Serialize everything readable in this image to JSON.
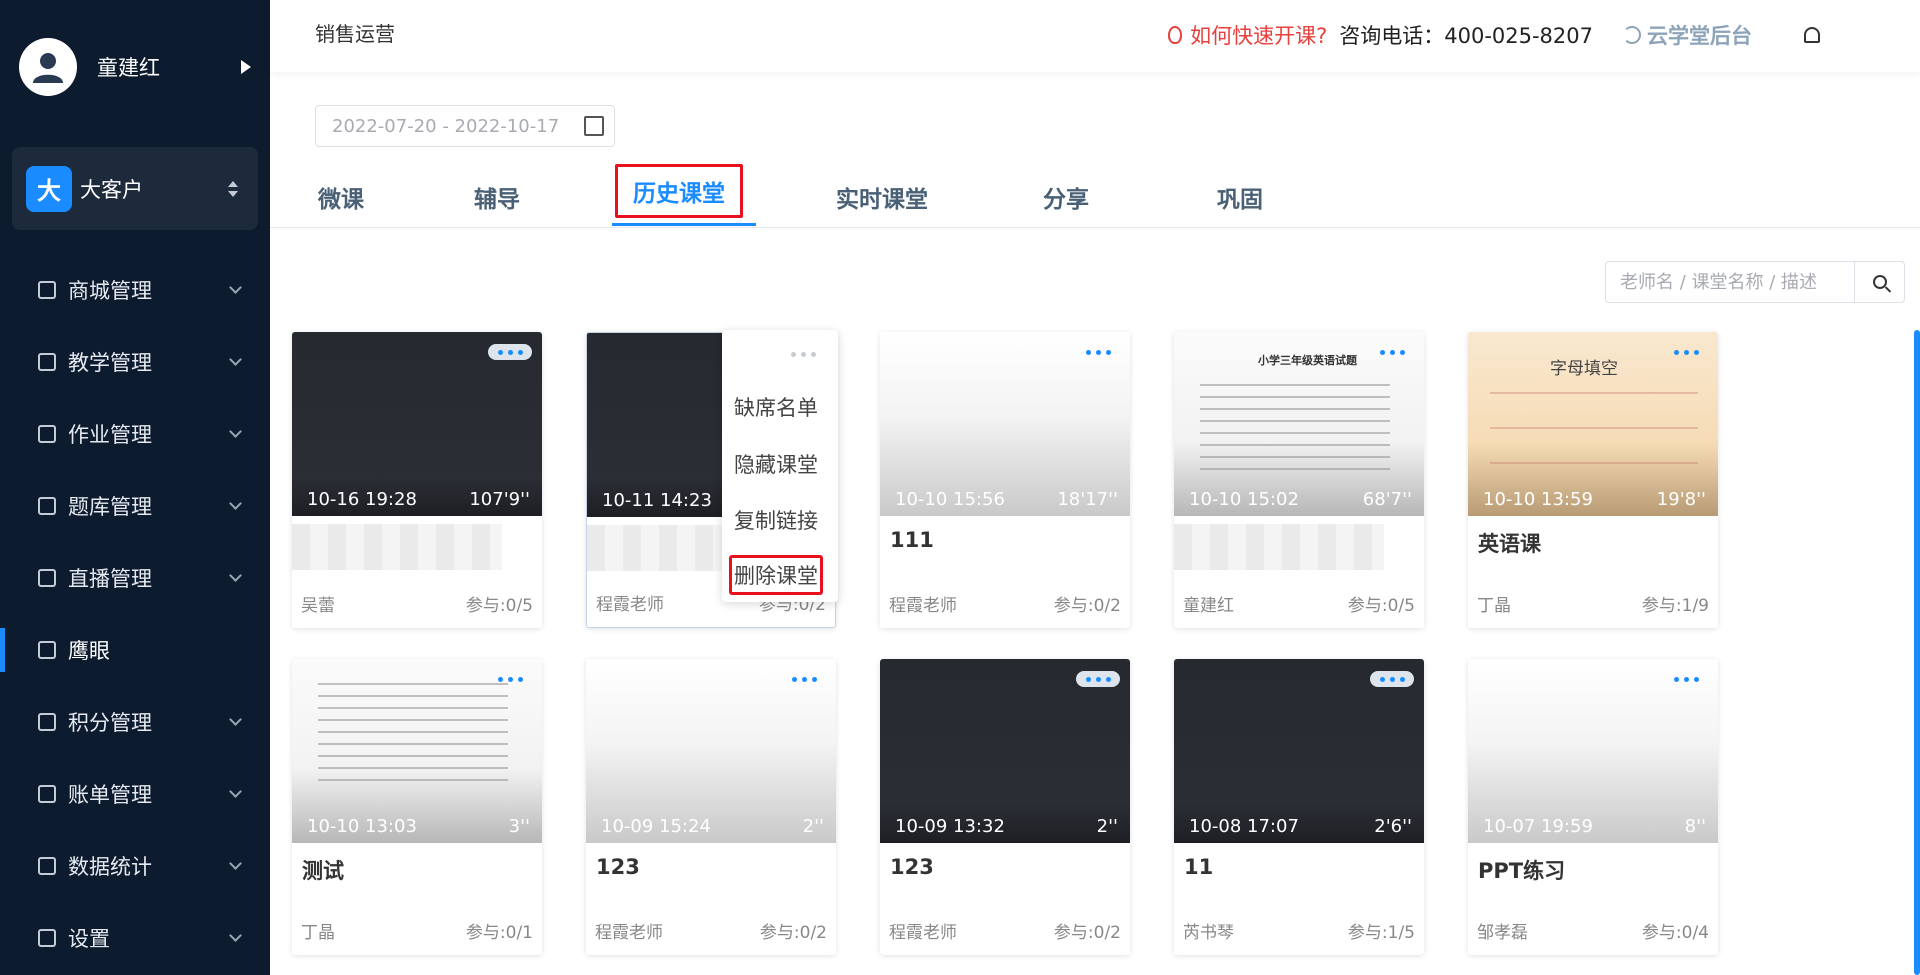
{
  "sidebar": {
    "user_name": "童建红",
    "org_logo_text": "大",
    "org_name": "大客户",
    "items": [
      {
        "label": "商城管理",
        "icon": "shop-icon",
        "active": false
      },
      {
        "label": "教学管理",
        "icon": "teaching-icon",
        "active": false
      },
      {
        "label": "作业管理",
        "icon": "homework-icon",
        "active": false
      },
      {
        "label": "题库管理",
        "icon": "question-bank-icon",
        "active": false
      },
      {
        "label": "直播管理",
        "icon": "live-icon",
        "active": false
      },
      {
        "label": "鹰眼",
        "icon": "eagle-eye-icon",
        "active": true
      },
      {
        "label": "积分管理",
        "icon": "star-icon",
        "active": false
      },
      {
        "label": "账单管理",
        "icon": "bill-icon",
        "active": false
      },
      {
        "label": "数据统计",
        "icon": "chart-icon",
        "active": false
      },
      {
        "label": "设置",
        "icon": "settings-icon",
        "active": false
      }
    ]
  },
  "header": {
    "title": "销售运营",
    "quick_link": "如何快速开课?",
    "phone": "咨询电话：400-025-8207",
    "backend_link": "云学堂后台"
  },
  "date_range": "2022-07-20 - 2022-10-17",
  "tabs": [
    {
      "label": "微课"
    },
    {
      "label": "辅导"
    },
    {
      "label": "历史课堂"
    },
    {
      "label": "实时课堂"
    },
    {
      "label": "分享"
    },
    {
      "label": "巩固"
    }
  ],
  "search": {
    "placeholder": "老师名 / 课堂名称 / 描述"
  },
  "cards": [
    {
      "date": "10-16 19:28",
      "duration": "107'9''",
      "title": "",
      "teacher": "吴蕾",
      "count": "参与:0/5"
    },
    {
      "date": "10-11 14:23",
      "duration": "",
      "title": "",
      "teacher": "程霞老师",
      "count": "参与:0/2"
    },
    {
      "date": "10-10 15:56",
      "duration": "18'17''",
      "title": "111",
      "teacher": "程霞老师",
      "count": "参与:0/2"
    },
    {
      "date": "10-10 15:02",
      "duration": "68'7''",
      "title": "",
      "teacher": "童建红",
      "count": "参与:0/5"
    },
    {
      "date": "10-10 13:59",
      "duration": "19'8''",
      "title": "英语课",
      "teacher": "丁晶",
      "count": "参与:1/9"
    },
    {
      "date": "10-10 13:03",
      "duration": "3''",
      "title": "测试",
      "teacher": "丁晶",
      "count": "参与:0/1"
    },
    {
      "date": "10-09 15:24",
      "duration": "2''",
      "title": "123",
      "teacher": "程霞老师",
      "count": "参与:0/2"
    },
    {
      "date": "10-09 13:32",
      "duration": "2''",
      "title": "123",
      "teacher": "程霞老师",
      "count": "参与:0/2"
    },
    {
      "date": "10-08 17:07",
      "duration": "2'6''",
      "title": "11",
      "teacher": "芮书琴",
      "count": "参与:1/5"
    },
    {
      "date": "10-07 19:59",
      "duration": "8''",
      "title": "PPT练习",
      "teacher": "邹孝磊",
      "count": "参与:0/4"
    }
  ],
  "thumb_texts": {
    "doc_heading": "小学三年级英语试题",
    "kids_heading": "字母填空"
  },
  "dropdown": {
    "items": [
      "缺席名单",
      "隐藏课堂",
      "复制链接",
      "删除课堂"
    ]
  },
  "colors": {
    "sidebar_bg": "#0d1b2e",
    "accent": "#1a8cff",
    "highlight_red": "#e8101c",
    "quick_link_red": "#e9403c"
  }
}
